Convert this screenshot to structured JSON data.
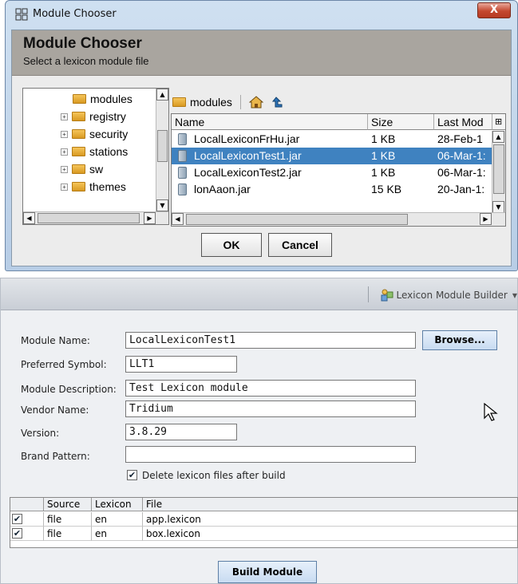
{
  "chooser": {
    "window_title": "Module Chooser",
    "close_label": "X",
    "header_title": "Module Chooser",
    "header_subtitle": "Select a lexicon module file",
    "tree_items": [
      {
        "label": "modules",
        "expandable": false
      },
      {
        "label": "registry",
        "expandable": true
      },
      {
        "label": "security",
        "expandable": true
      },
      {
        "label": "stations",
        "expandable": true
      },
      {
        "label": "sw",
        "expandable": true
      },
      {
        "label": "themes",
        "expandable": true
      }
    ],
    "path_label": "modules",
    "columns": [
      "Name",
      "Size",
      "Last Mod"
    ],
    "files": [
      {
        "name": "LocalLexiconFrHu.jar",
        "size": "1 KB",
        "modified": "28-Feb-1",
        "selected": false
      },
      {
        "name": "LocalLexiconTest1.jar",
        "size": "1 KB",
        "modified": "06-Mar-1:",
        "selected": true
      },
      {
        "name": "LocalLexiconTest2.jar",
        "size": "1 KB",
        "modified": "06-Mar-1:",
        "selected": false
      },
      {
        "name": "lonAaon.jar",
        "size": "15 KB",
        "modified": "20-Jan-1:",
        "selected": false
      }
    ],
    "ok_label": "OK",
    "cancel_label": "Cancel"
  },
  "builder": {
    "tab_label": "Lexicon Module Builder",
    "fields": {
      "module_name": {
        "label": "Module Name:",
        "value": "LocalLexiconTest1"
      },
      "preferred_symbol": {
        "label": "Preferred Symbol:",
        "value": "LLT1"
      },
      "module_description": {
        "label": "Module Description:",
        "value": "Test Lexicon module"
      },
      "vendor_name": {
        "label": "Vendor Name:",
        "value": "Tridium"
      },
      "version": {
        "label": "Version:",
        "value": "3.8.29"
      },
      "brand_pattern": {
        "label": "Brand Pattern:",
        "value": ""
      }
    },
    "browse_label": "Browse...",
    "delete_checkbox": {
      "label": "Delete lexicon files after build",
      "checked": true
    },
    "table_columns": [
      "Source",
      "Lexicon",
      "File"
    ],
    "table_rows": [
      {
        "checked": true,
        "source": "file",
        "lexicon": "en",
        "file": "app.lexicon"
      },
      {
        "checked": true,
        "source": "file",
        "lexicon": "en",
        "file": "box.lexicon"
      }
    ],
    "build_label": "Build Module"
  },
  "colors": {
    "selection": "#3f82c0",
    "header_band": "#a9a59f",
    "button_blue": "#c8dbf1"
  }
}
